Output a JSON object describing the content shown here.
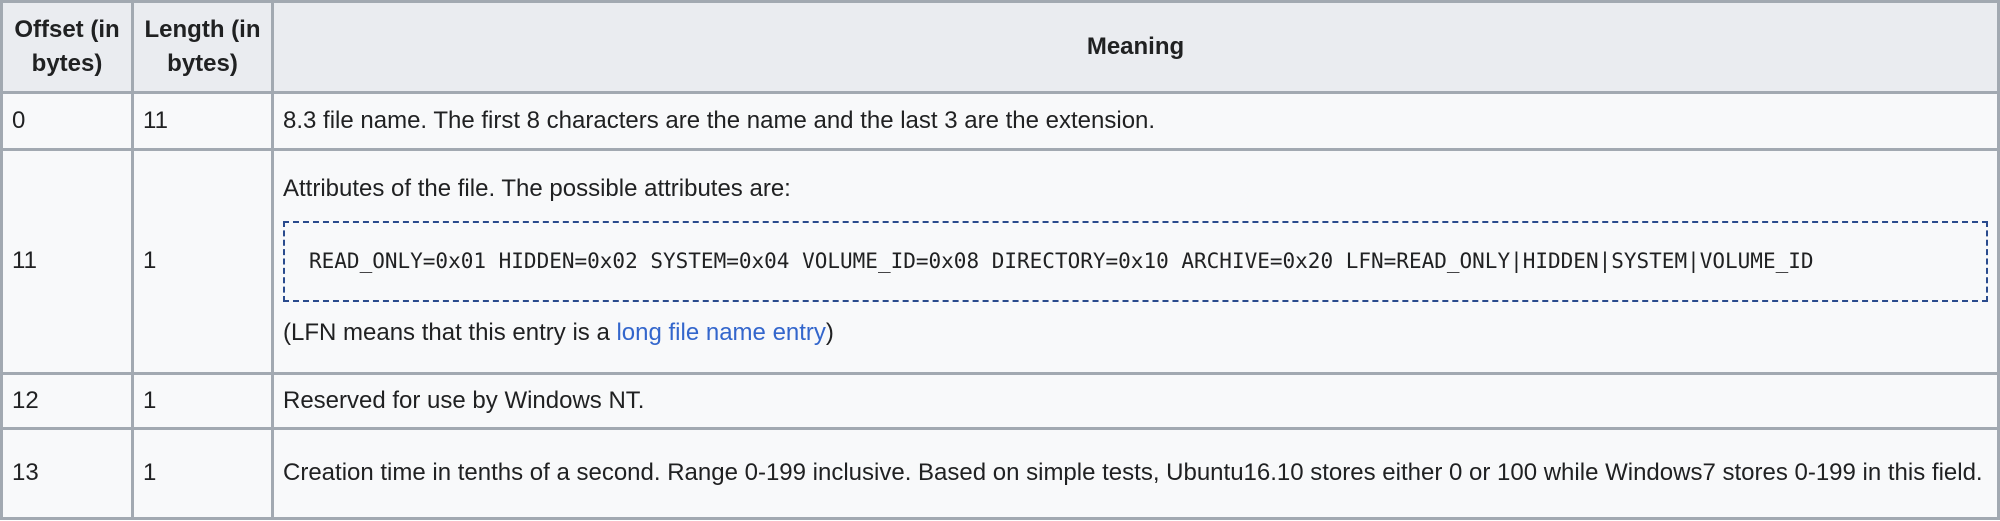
{
  "table": {
    "headers": {
      "offset": "Offset (in bytes)",
      "length": "Length (in bytes)",
      "meaning": "Meaning"
    },
    "rows": [
      {
        "offset": "0",
        "length": "11",
        "meaning": "8.3 file name. The first 8 characters are the name and the last 3 are the extension."
      },
      {
        "offset": "11",
        "length": "1",
        "meaning_intro": "Attributes of the file. The possible attributes are:",
        "meaning_code": "READ_ONLY=0x01 HIDDEN=0x02 SYSTEM=0x04 VOLUME_ID=0x08 DIRECTORY=0x10 ARCHIVE=0x20 LFN=READ_ONLY|HIDDEN|SYSTEM|VOLUME_ID",
        "meaning_note_prefix": "(LFN means that this entry is a ",
        "meaning_note_link": "long file name entry",
        "meaning_note_suffix": ")"
      },
      {
        "offset": "12",
        "length": "1",
        "meaning": "Reserved for use by Windows NT."
      },
      {
        "offset": "13",
        "length": "1",
        "meaning": "Creation time in tenths of a second. Range 0-199 inclusive. Based on simple tests, Ubuntu16.10 stores either 0 or 100 while Windows7 stores 0-199 in this field."
      }
    ]
  },
  "colors": {
    "border": "#a2a9b1",
    "header_bg": "#eaecf0",
    "cell_bg": "#f8f9fa",
    "link": "#3366cc",
    "code_border": "#2a4b8d"
  }
}
